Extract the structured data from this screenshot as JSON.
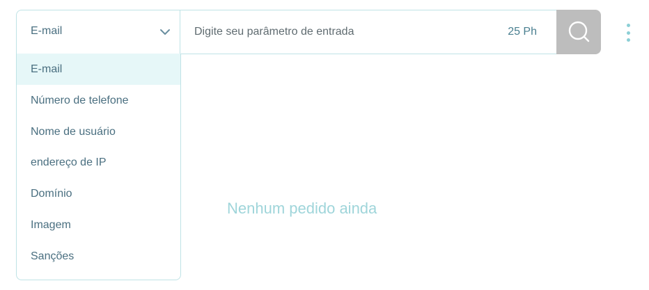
{
  "search": {
    "selected_type": "E-mail",
    "placeholder": "Digite seu parâmetro de entrada",
    "value": "",
    "cost": "25 Ph"
  },
  "icons": {
    "chevron": "chevron-down-icon",
    "search": "search-icon",
    "more": "more-vertical-icon"
  },
  "dropdown": {
    "options": [
      {
        "label": "E-mail",
        "selected": true
      },
      {
        "label": "Número de telefone"
      },
      {
        "label": "Nome de usuário"
      },
      {
        "label": "endereço de IP"
      },
      {
        "label": "Domínio"
      },
      {
        "label": "Imagem"
      },
      {
        "label": "Sanções"
      }
    ]
  },
  "results": {
    "empty_message": "Nenhum pedido ainda"
  },
  "colors": {
    "accent": "#8ccfd6",
    "border": "#bfe3e6",
    "text": "#4a6f80",
    "selected_bg": "#e6f7f8",
    "search_button": "#bdbdbd",
    "empty_text": "#9fd5da"
  }
}
